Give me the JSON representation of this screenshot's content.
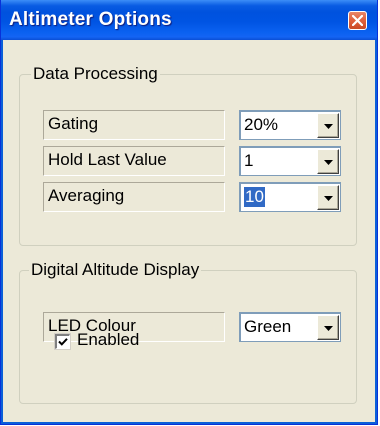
{
  "window": {
    "title": "Altimeter Options",
    "close_icon": "close-icon",
    "accent": "#0054e3"
  },
  "data_processing": {
    "caption": "Data Processing",
    "rows": [
      {
        "label": "Gating",
        "value": "20%",
        "selected": false
      },
      {
        "label": "Hold Last Value",
        "value": "1",
        "selected": false
      },
      {
        "label": "Averaging",
        "value": "10",
        "selected": true
      }
    ]
  },
  "digital_altitude_display": {
    "caption": "Digital Altitude Display",
    "led_colour": {
      "label": "LED Colour",
      "value": "Green"
    },
    "enabled": {
      "label": "Enabled",
      "checked": true
    }
  }
}
